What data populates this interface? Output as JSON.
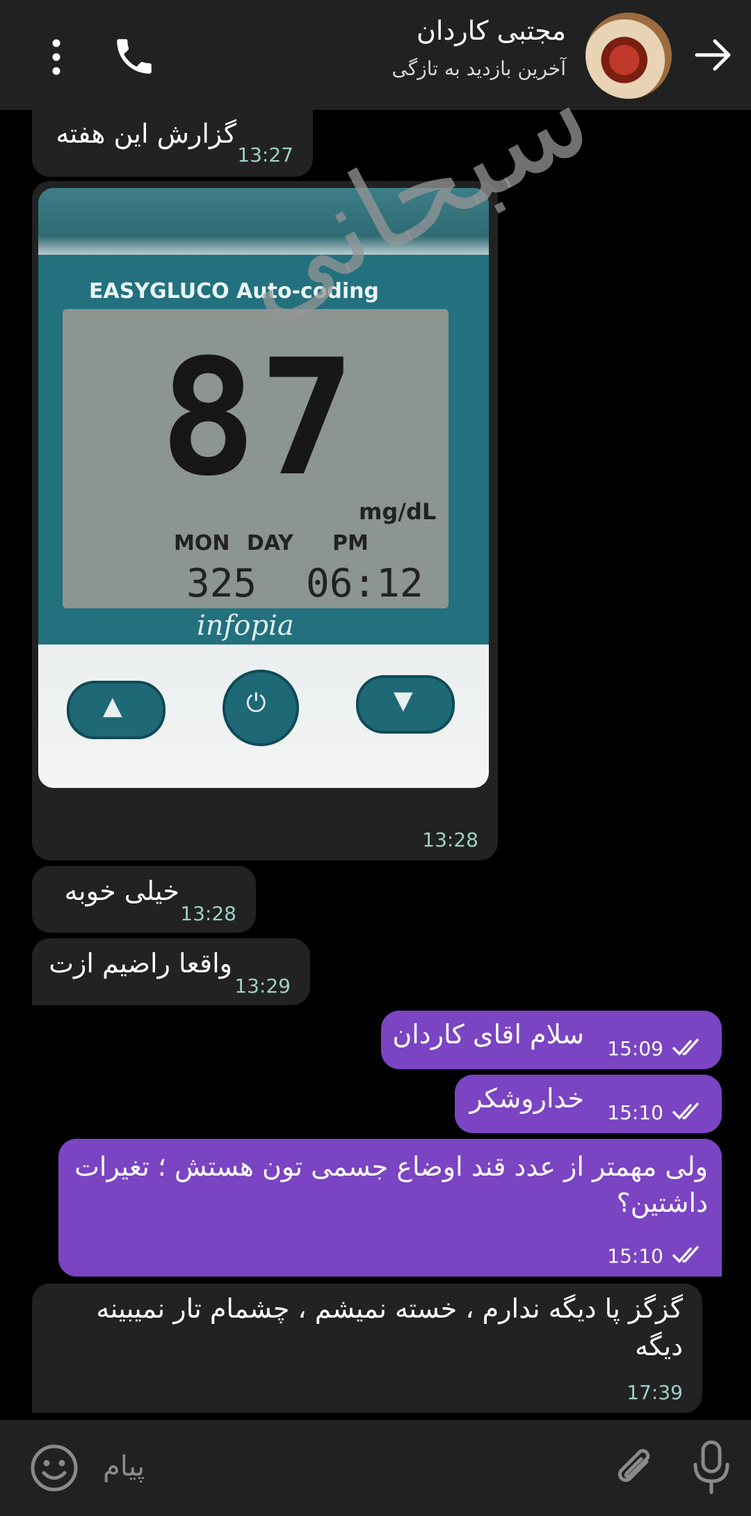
{
  "header": {
    "contact_name": "مجتبی کاردان",
    "status": "آخرین بازدید به تازگی"
  },
  "messages": [
    {
      "text": "گزارش این هفته",
      "time": "13:27",
      "direction": "incoming"
    },
    {
      "type": "image",
      "time": "13:28",
      "direction": "incoming",
      "image_text": {
        "brand": "EASYGLUCO Auto-coding",
        "reading": "87",
        "unit": "mg/dL",
        "day_labels": "MON DAY",
        "pm": "PM",
        "date": "325",
        "clock": "06:12",
        "maker": "infopia",
        "watermark": "سبحانی"
      }
    },
    {
      "text": "خیلی خوبه",
      "time": "13:28",
      "direction": "incoming"
    },
    {
      "text": "واقعا راضیم ازت",
      "time": "13:29",
      "direction": "incoming"
    },
    {
      "text": "سلام اقای کاردان",
      "time": "15:09",
      "direction": "outgoing"
    },
    {
      "text": "خداروشکر",
      "time": "15:10",
      "direction": "outgoing"
    },
    {
      "text_line1": "ولی مهمتر از عدد قند اوضاع جسمی تون هستش ؛ تغیرات",
      "text_line2": "داشتین؟",
      "time": "15:10",
      "direction": "outgoing"
    },
    {
      "text_line1": "گزگز پا دیگه ندارم ، خسته نمیشم ، چشمام تار نمیبینه",
      "text_line2": "دیگه",
      "time": "17:39",
      "direction": "incoming"
    }
  ],
  "composer": {
    "placeholder": "پیام"
  },
  "colors": {
    "header_bg": "#212121",
    "chat_bg": "#000000",
    "incoming_bubble": "#222222",
    "outgoing_bubble": "#7a44c2",
    "incoming_time": "#9fd0c6"
  },
  "icons": [
    "back-arrow-icon",
    "phone-icon",
    "more-vertical-icon",
    "read-receipt-icon",
    "emoji-icon",
    "attach-icon",
    "microphone-icon"
  ]
}
